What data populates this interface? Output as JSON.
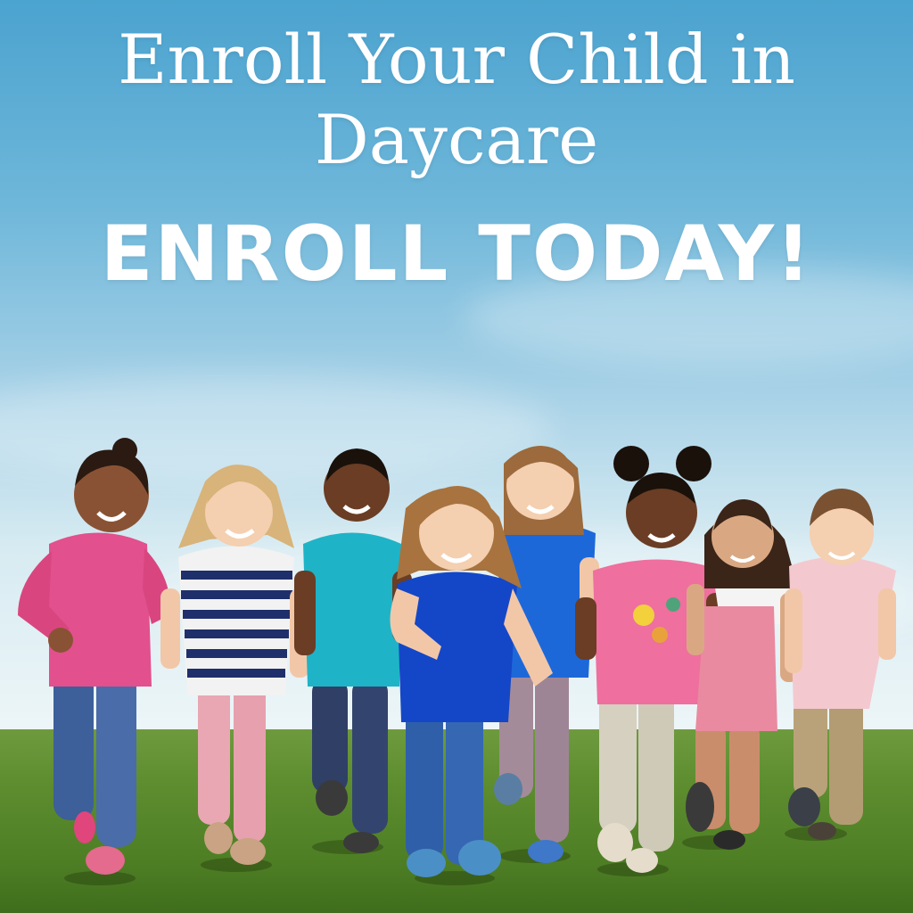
{
  "headline": {
    "title": "Enroll Your Child in Daycare",
    "cta": "ENROLL TODAY!"
  },
  "scene": {
    "description_icon": "children-running-icon",
    "colors": {
      "sky_top": "#4ba3cf",
      "sky_bottom": "#eef6f8",
      "grass": "#5d8d2f",
      "text": "#ffffff"
    }
  }
}
